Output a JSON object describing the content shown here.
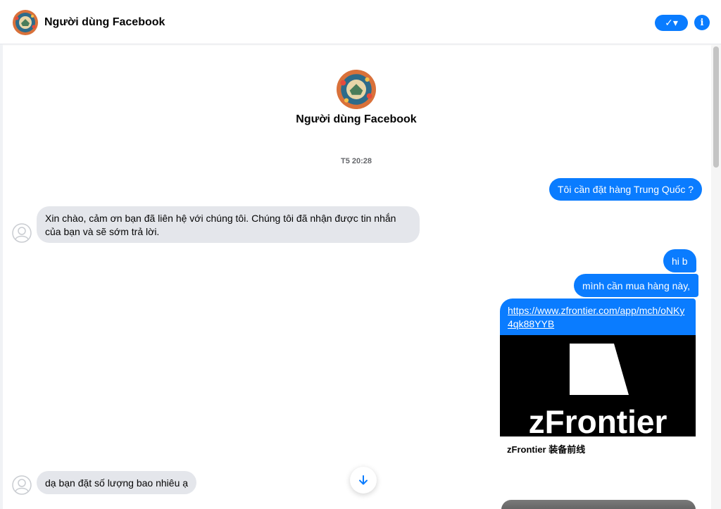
{
  "header": {
    "title": "Người dùng Facebook",
    "check_icon": "check-dropdown-icon",
    "info_icon": "info-icon",
    "info_glyph": "i",
    "check_glyph": "✓▾"
  },
  "profile": {
    "name": "Người dùng Facebook",
    "avatar_icon": "profile-avatar-icon"
  },
  "conversation": {
    "timestamp": "T5 20:28",
    "messages": [
      {
        "direction": "out",
        "text": "Tôi cần đặt hàng Trung Quốc ?"
      },
      {
        "direction": "in",
        "text": "Xin chào, cảm ơn bạn đã liên hệ với chúng tôi. Chúng tôi đã nhận được tin nhắn của bạn và sẽ sớm trả lời."
      },
      {
        "direction": "out",
        "text": "hi b"
      },
      {
        "direction": "out",
        "text": "mình cần mua hàng này,"
      },
      {
        "direction": "out",
        "text": "https://www.zfrontier.com/app/mch/oNKy4qk88YYB",
        "link_preview": {
          "brand": "zFrontier",
          "title": "zFrontier 装备前线"
        }
      },
      {
        "direction": "in",
        "text": "dạ bạn đặt số lượng bao nhiêu ạ"
      }
    ]
  },
  "colors": {
    "accent": "#0a7cff",
    "incoming_bubble": "#e4e6eb"
  }
}
